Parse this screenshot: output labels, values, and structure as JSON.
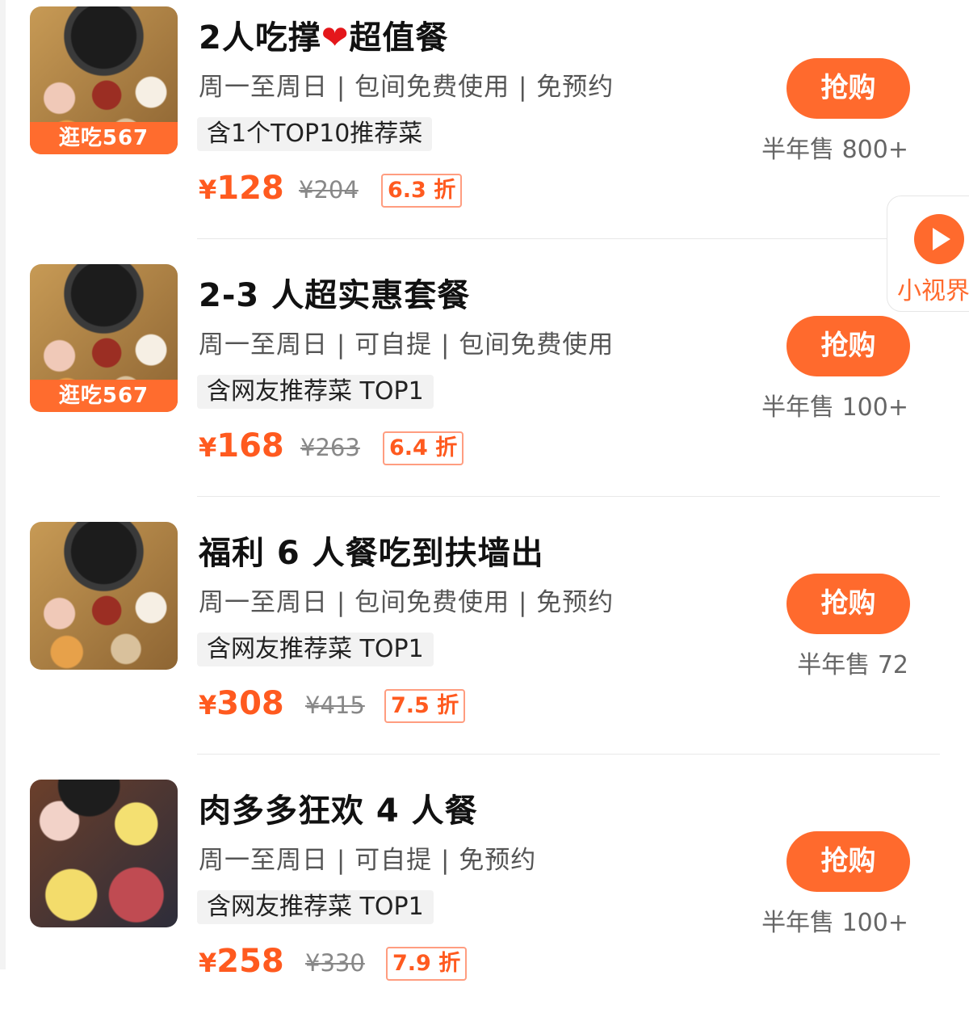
{
  "deals": [
    {
      "thumb_badge": "逛吃567",
      "title_before_heart": "2人吃撑",
      "title_after_heart": "超值餐",
      "details": "周一至周日 | 包间免费使用 | 免预约",
      "tag": "含1个TOP10推荐菜",
      "price": "128",
      "original_price": "¥204",
      "discount": "6.3 折",
      "buy_label": "抢购",
      "sales": "半年售 800+"
    },
    {
      "thumb_badge": "逛吃567",
      "title": "2-3 人超实惠套餐",
      "details": "周一至周日 | 可自提 | 包间免费使用",
      "tag": "含网友推荐菜 TOP1",
      "price": "168",
      "original_price": "¥263",
      "discount": "6.4 折",
      "buy_label": "抢购",
      "sales": "半年售 100+"
    },
    {
      "title": "福利 6 人餐吃到扶墙出",
      "details": "周一至周日 | 包间免费使用 | 免预约",
      "tag": "含网友推荐菜 TOP1",
      "price": "308",
      "original_price": "¥415",
      "discount": "7.5 折",
      "buy_label": "抢购",
      "sales": "半年售 72"
    },
    {
      "title": "肉多多狂欢 4 人餐",
      "details": "周一至周日 | 可自提 | 免预约",
      "tag": "含网友推荐菜 TOP1",
      "price": "258",
      "original_price": "¥330",
      "discount": "7.9 折",
      "buy_label": "抢购",
      "sales": "半年售 100+"
    }
  ],
  "currency": "¥",
  "side_tab": {
    "icon": "play-icon",
    "label": "小视界"
  },
  "colors": {
    "accent": "#ff6a2d",
    "price": "#ff5a1f",
    "heart": "#e4171b"
  }
}
